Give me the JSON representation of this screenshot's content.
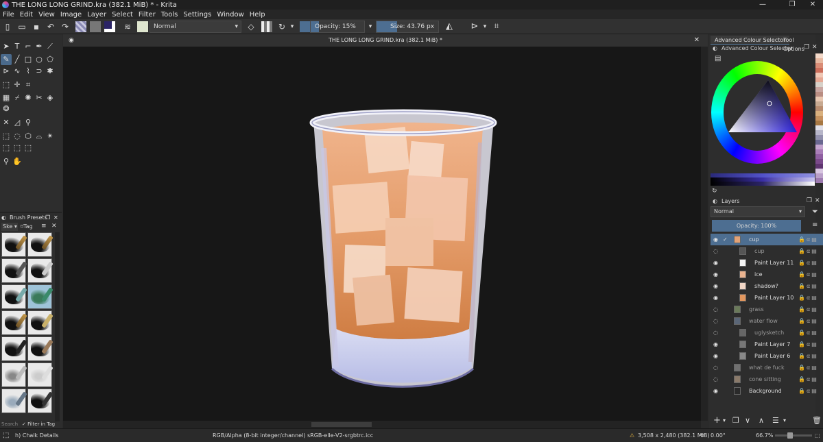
{
  "window": {
    "title": "THE LONG LONG GRIND.kra (382.1 MiB) * - Krita",
    "controls": [
      "—",
      "❐",
      "✕"
    ]
  },
  "menu": [
    "File",
    "Edit",
    "View",
    "Image",
    "Layer",
    "Select",
    "Filter",
    "Tools",
    "Settings",
    "Window",
    "Help"
  ],
  "toolbar": {
    "blend_mode": "Normal",
    "opacity_label": "Opacity: 15%",
    "opacity_value": 0.15,
    "size_label": "Size: 43.76 px",
    "foreground_color": "#2b2466",
    "background_color": "#ffffff"
  },
  "document": {
    "tab_title": "THE LONG LONG GRIND.kra (382.1 MiB) *"
  },
  "brush_presets": {
    "title": "Brush Presets",
    "tag_select": "Ske",
    "tag_button": "Tag",
    "search_placeholder": "Search",
    "filter_in_tag": "Filter in Tag",
    "selected_preset": "h) Chalk Details"
  },
  "color_selector": {
    "tab_active": "Advanced Colour Selector",
    "tab_other": "Tool Options",
    "docker_title": "Advanced Colour Selector"
  },
  "layers": {
    "title": "Layers",
    "blend_mode": "Normal",
    "opacity_label": "Opacity: 100%",
    "items": [
      {
        "name": "cup",
        "visible": true,
        "selected": true,
        "checked": true,
        "thumb": "#e2a277",
        "indent": 1
      },
      {
        "name": "cup",
        "visible": false,
        "selected": false,
        "thumb": "#555555",
        "indent": 2
      },
      {
        "name": "Paint Layer 11",
        "visible": true,
        "selected": false,
        "thumb": "#f4f4f4",
        "indent": 2
      },
      {
        "name": "ice",
        "visible": true,
        "selected": false,
        "thumb": "#eab38f",
        "indent": 2
      },
      {
        "name": "shadow?",
        "visible": true,
        "selected": false,
        "thumb": "#f1d6c6",
        "indent": 2
      },
      {
        "name": "Paint Layer 10",
        "visible": true,
        "selected": false,
        "thumb": "#e1965e",
        "indent": 2
      },
      {
        "name": "grass",
        "visible": false,
        "selected": false,
        "thumb": "#6a7a5a",
        "indent": 1
      },
      {
        "name": "water flow",
        "visible": false,
        "selected": false,
        "thumb": "#5a6677",
        "indent": 1
      },
      {
        "name": "uglysketch",
        "visible": false,
        "selected": false,
        "thumb": "#666666",
        "indent": 2
      },
      {
        "name": "Paint Layer 7",
        "visible": true,
        "selected": false,
        "thumb": "#777777",
        "indent": 2
      },
      {
        "name": "Paint Layer 6",
        "visible": true,
        "selected": false,
        "thumb": "#888888",
        "indent": 2
      },
      {
        "name": "what de fuck",
        "visible": false,
        "selected": false,
        "thumb": "#707070",
        "indent": 1
      },
      {
        "name": "cone sitting",
        "visible": false,
        "selected": false,
        "thumb": "#8a7a6a",
        "indent": 1
      },
      {
        "name": "Background",
        "visible": true,
        "selected": false,
        "thumb": "#2a2a2a",
        "indent": 1
      }
    ]
  },
  "status": {
    "color_model": "RGB/Alpha (8-bit integer/channel)  sRGB-elle-V2-srgbtrc.icc",
    "image_size": "3,508 x 2,480 (382.1 MiB)",
    "rotation": "0.00°",
    "zoom": "66.7%"
  },
  "palette_colors": [
    "#f3d9c9",
    "#e7b8a0",
    "#d98c76",
    "#cc6e5b",
    "#f0c7b4",
    "#e6a995",
    "#d7d1c9",
    "#c8a5a0",
    "#b98d82",
    "#e7c6b0",
    "#c7a991",
    "#b88c6f",
    "#d9b07e",
    "#c4915e",
    "#a77843",
    "#dfdfe8",
    "#b7b6c9",
    "#9290ad",
    "#6a6891",
    "#c3a4ce",
    "#a97eb8",
    "#8f5fa1",
    "#7b4a8b",
    "#5f3570",
    "#d8c6e1",
    "#b99fc8",
    "#9d7ab0"
  ]
}
